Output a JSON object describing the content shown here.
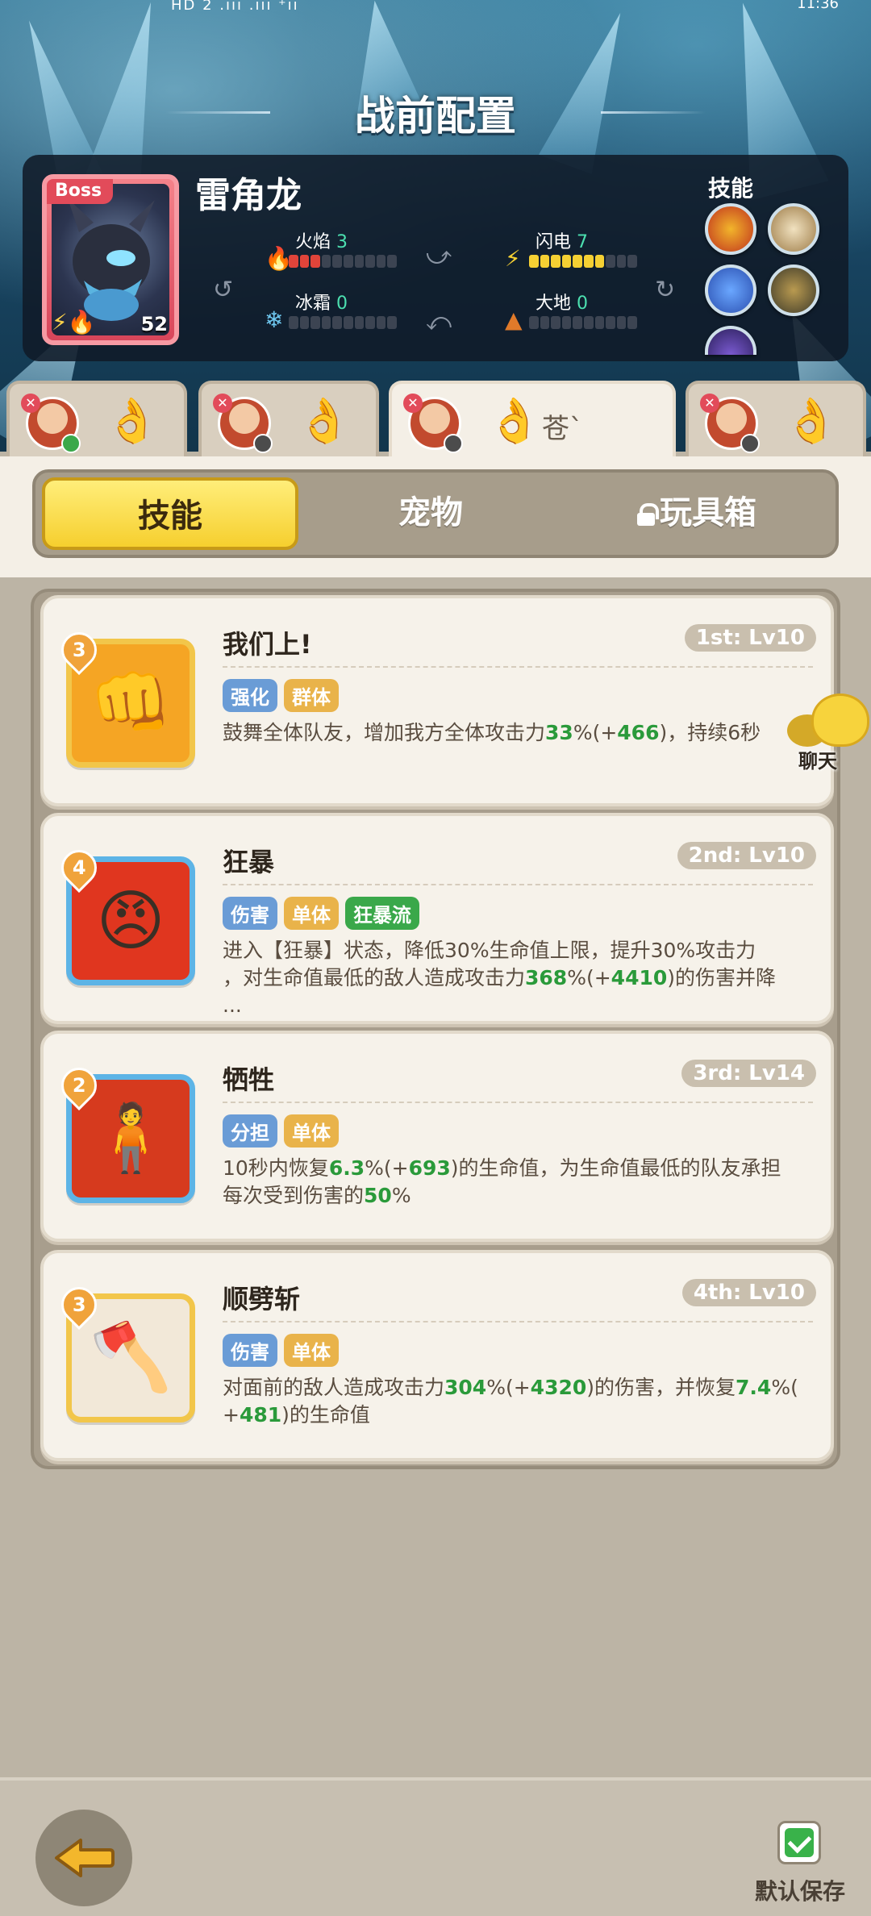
{
  "status_bar": {
    "left": "HD 2  .ııı .ııı ⁺ıı",
    "right": "11:36"
  },
  "header": {
    "title": "战前配置"
  },
  "boss": {
    "tag": "Boss",
    "name": "雷角龙",
    "level": "52",
    "skills_label": "技能",
    "stats": [
      {
        "name": "火焰",
        "value": "3",
        "filled": 3,
        "color": "#e0443a",
        "icon": "fire-icon"
      },
      {
        "name": "闪电",
        "value": "7",
        "filled": 7,
        "color": "#f5d033",
        "icon": "lightning-icon"
      },
      {
        "name": "冰霜",
        "value": "0",
        "filled": 0,
        "color": "#6fc8f0",
        "icon": "snowflake-icon"
      },
      {
        "name": "大地",
        "value": "0",
        "filled": 0,
        "color": "#e07a2a",
        "icon": "mountain-icon"
      }
    ]
  },
  "hero_tabs": [
    {
      "text": "",
      "badge": "green"
    },
    {
      "text": "",
      "badge": "gray"
    },
    {
      "text": "苍`",
      "badge": "gray",
      "active": true
    },
    {
      "text": "",
      "badge": "gray"
    }
  ],
  "segment": {
    "skills": "技能",
    "pets": "宠物",
    "toybox": "玩具箱"
  },
  "chat": {
    "label": "聊天"
  },
  "cards": [
    {
      "cost": "3",
      "name": "我们上!",
      "slot": "1st: Lv10",
      "tags": [
        {
          "text": "强化",
          "style": "blue"
        },
        {
          "text": "群体",
          "style": "orange"
        }
      ],
      "desc": [
        {
          "t": "鼓舞全体队友，增加我方全体攻击力"
        },
        {
          "t": "33",
          "hl": true
        },
        {
          "t": "%(+"
        },
        {
          "t": "466",
          "hl": true
        },
        {
          "t": ")，持续6秒"
        }
      ],
      "frame": "#f2c64a",
      "bg": "#f5a524",
      "glyph": "👊"
    },
    {
      "cost": "4",
      "name": "狂暴",
      "slot": "2nd: Lv10",
      "tags": [
        {
          "text": "伤害",
          "style": "blue"
        },
        {
          "text": "单体",
          "style": "orange"
        },
        {
          "text": "狂暴流",
          "style": "green"
        }
      ],
      "desc": [
        {
          "t": "进入【狂暴】状态，降低30%生命值上限，提升30%攻击力\n，对生命值最低的敌人造成攻击力"
        },
        {
          "t": "368",
          "hl": true
        },
        {
          "t": "%(+"
        },
        {
          "t": "4410",
          "hl": true
        },
        {
          "t": ")的伤害并降\n..."
        }
      ],
      "frame": "#5db4e6",
      "bg": "#e0361f",
      "glyph": "😠"
    },
    {
      "cost": "2",
      "name": "牺牲",
      "slot": "3rd: Lv14",
      "tags": [
        {
          "text": "分担",
          "style": "blue"
        },
        {
          "text": "单体",
          "style": "orange"
        }
      ],
      "desc": [
        {
          "t": "10秒内恢复"
        },
        {
          "t": "6.3",
          "hl": true
        },
        {
          "t": "%(+"
        },
        {
          "t": "693",
          "hl": true
        },
        {
          "t": ")的生命值，为生命值最低的队友承担\n每次受到伤害的"
        },
        {
          "t": "50",
          "hl": true
        },
        {
          "t": "%"
        }
      ],
      "frame": "#5db4e6",
      "bg": "#d63a1e",
      "glyph": "🧍"
    },
    {
      "cost": "3",
      "name": "顺劈斩",
      "slot": "4th: Lv10",
      "tags": [
        {
          "text": "伤害",
          "style": "blue"
        },
        {
          "text": "单体",
          "style": "orange"
        }
      ],
      "desc": [
        {
          "t": "对面前的敌人造成攻击力"
        },
        {
          "t": "304",
          "hl": true
        },
        {
          "t": "%(+"
        },
        {
          "t": "4320",
          "hl": true
        },
        {
          "t": ")的伤害，并恢复"
        },
        {
          "t": "7.4",
          "hl": true
        },
        {
          "t": "%(\n+"
        },
        {
          "t": "481",
          "hl": true
        },
        {
          "t": ")的生命值"
        }
      ],
      "frame": "#f2c64a",
      "bg": "#f2e8d8",
      "glyph": "🪓"
    }
  ],
  "footer": {
    "save_label": "默认保存"
  }
}
